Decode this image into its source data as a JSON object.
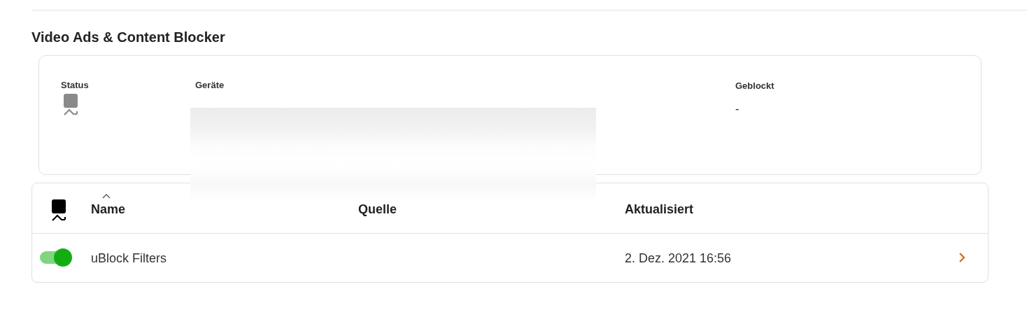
{
  "section": {
    "title": "Video Ads & Content Blocker"
  },
  "summary": {
    "fields": [
      {
        "kind": "icon",
        "label": "Status"
      },
      {
        "kind": "redacted",
        "label": "Geräte"
      },
      {
        "kind": "text",
        "label": "Geblockt",
        "value": "-"
      }
    ]
  },
  "table": {
    "columns": [
      {
        "kind": "icon"
      },
      {
        "kind": "text",
        "label": "Name",
        "sorted": true
      },
      {
        "kind": "text",
        "label": "Quelle",
        "sorted": false
      },
      {
        "kind": "text",
        "label": "Aktualisiert",
        "sorted": false
      }
    ],
    "rows": [
      {
        "on": true,
        "name": "uBlock Filters",
        "updated": "2. Dez. 2021 16:56"
      }
    ]
  }
}
